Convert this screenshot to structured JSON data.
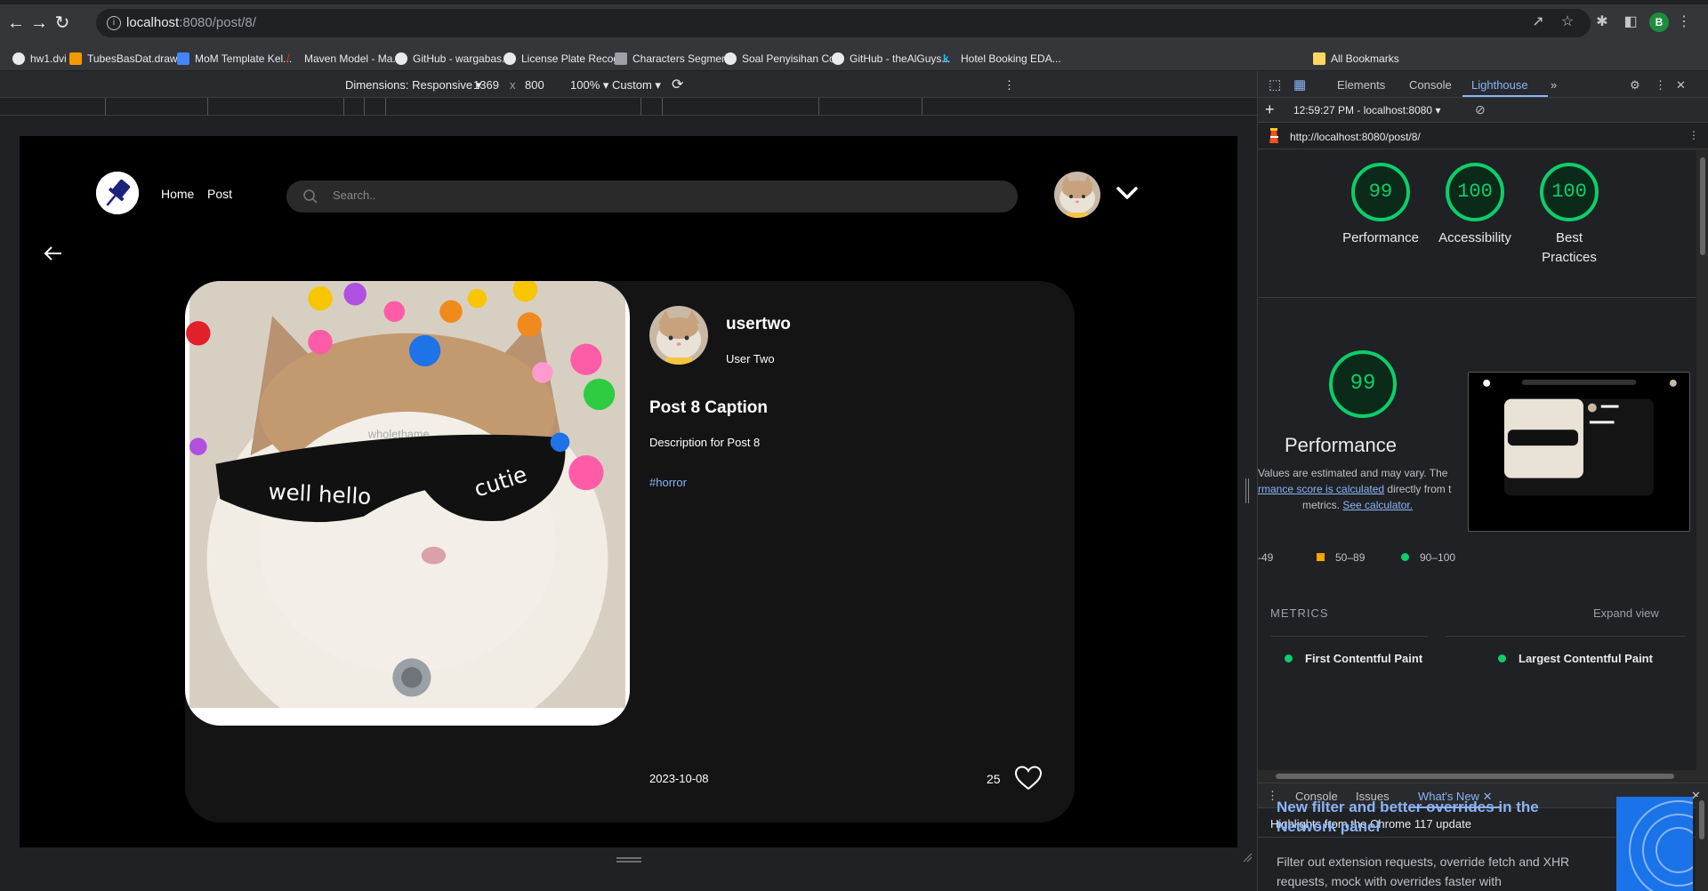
{
  "browser": {
    "url_host": "localhost",
    "url_rest": ":8080/post/8/",
    "profile_initial": "B",
    "bookmarks": [
      {
        "label": "hw1.dvi",
        "color": "#e8eaed"
      },
      {
        "label": "TubesBasDat.drawi...",
        "color": "#f29900"
      },
      {
        "label": "MoM Template Kel...",
        "color": "#4285f4"
      },
      {
        "label": "Maven Model - Ma...",
        "color": "#d93025"
      },
      {
        "label": "GitHub - wargabas...",
        "color": "#e8eaed"
      },
      {
        "label": "License Plate Recog...",
        "color": "#e8eaed"
      },
      {
        "label": "Characters Segmen...",
        "color": "#9aa0a6"
      },
      {
        "label": "Soal Penyisihan Co...",
        "color": "#e8eaed"
      },
      {
        "label": "GitHub - theAlGuys...",
        "color": "#e8eaed"
      },
      {
        "label": "Hotel Booking EDA...",
        "color": "#20beff"
      }
    ],
    "all_bookmarks": "All Bookmarks"
  },
  "device_toolbar": {
    "dimensions_label": "Dimensions: Responsive",
    "width": "1369",
    "times": "x",
    "height": "800",
    "zoom": "100%",
    "throttle": "Custom"
  },
  "site": {
    "nav": {
      "home": "Home",
      "post": "Post"
    },
    "search_placeholder": "Search..",
    "post": {
      "username": "usertwo",
      "full_name": "User Two",
      "caption": "Post 8 Caption",
      "description": "Description for Post 8",
      "tag": "#horror",
      "date": "2023-10-08",
      "likes": "25",
      "image_text": {
        "left_lens": "well hello",
        "right_lens": "cutie",
        "watermark": "wholethame"
      }
    }
  },
  "devtools": {
    "tabs": {
      "elements": "Elements",
      "console": "Console",
      "lighthouse": "Lighthouse"
    },
    "report_time": "12:59:27 PM - localhost:8080",
    "report_url": "http://localhost:8080/post/8/",
    "scores": [
      {
        "label": "Performance",
        "score": 99
      },
      {
        "label": "Accessibility",
        "score": 100
      },
      {
        "label": "Best Practices",
        "score": 100
      }
    ],
    "performance": {
      "score": 99,
      "title": "Performance",
      "note_line1": "Values are estimated and may vary. The",
      "note_link1": "rmance score is calculated",
      "note_line2_rest": "directly from t",
      "note_line3": "metrics.",
      "note_link2": "See calculator."
    },
    "legend": {
      "low": "-49",
      "mid": "50–89",
      "high": "90–100"
    },
    "metrics_heading": "METRICS",
    "expand_view": "Expand view",
    "metrics": {
      "fcp": "First Contentful Paint",
      "lcp": "Largest Contentful Paint"
    },
    "drawer": {
      "tabs": {
        "console": "Console",
        "issues": "Issues",
        "whats_new": "What's New"
      },
      "highlight": "Highlights from the Chrome 117 update",
      "article_title": "New filter and better overrides in the Network panel",
      "article_body": "Filter out extension requests, override fetch and XHR requests, mock with overrides faster with"
    }
  },
  "colors": {
    "accent": "#0cce6b",
    "link": "#8ab4f8",
    "card": "#141414"
  }
}
